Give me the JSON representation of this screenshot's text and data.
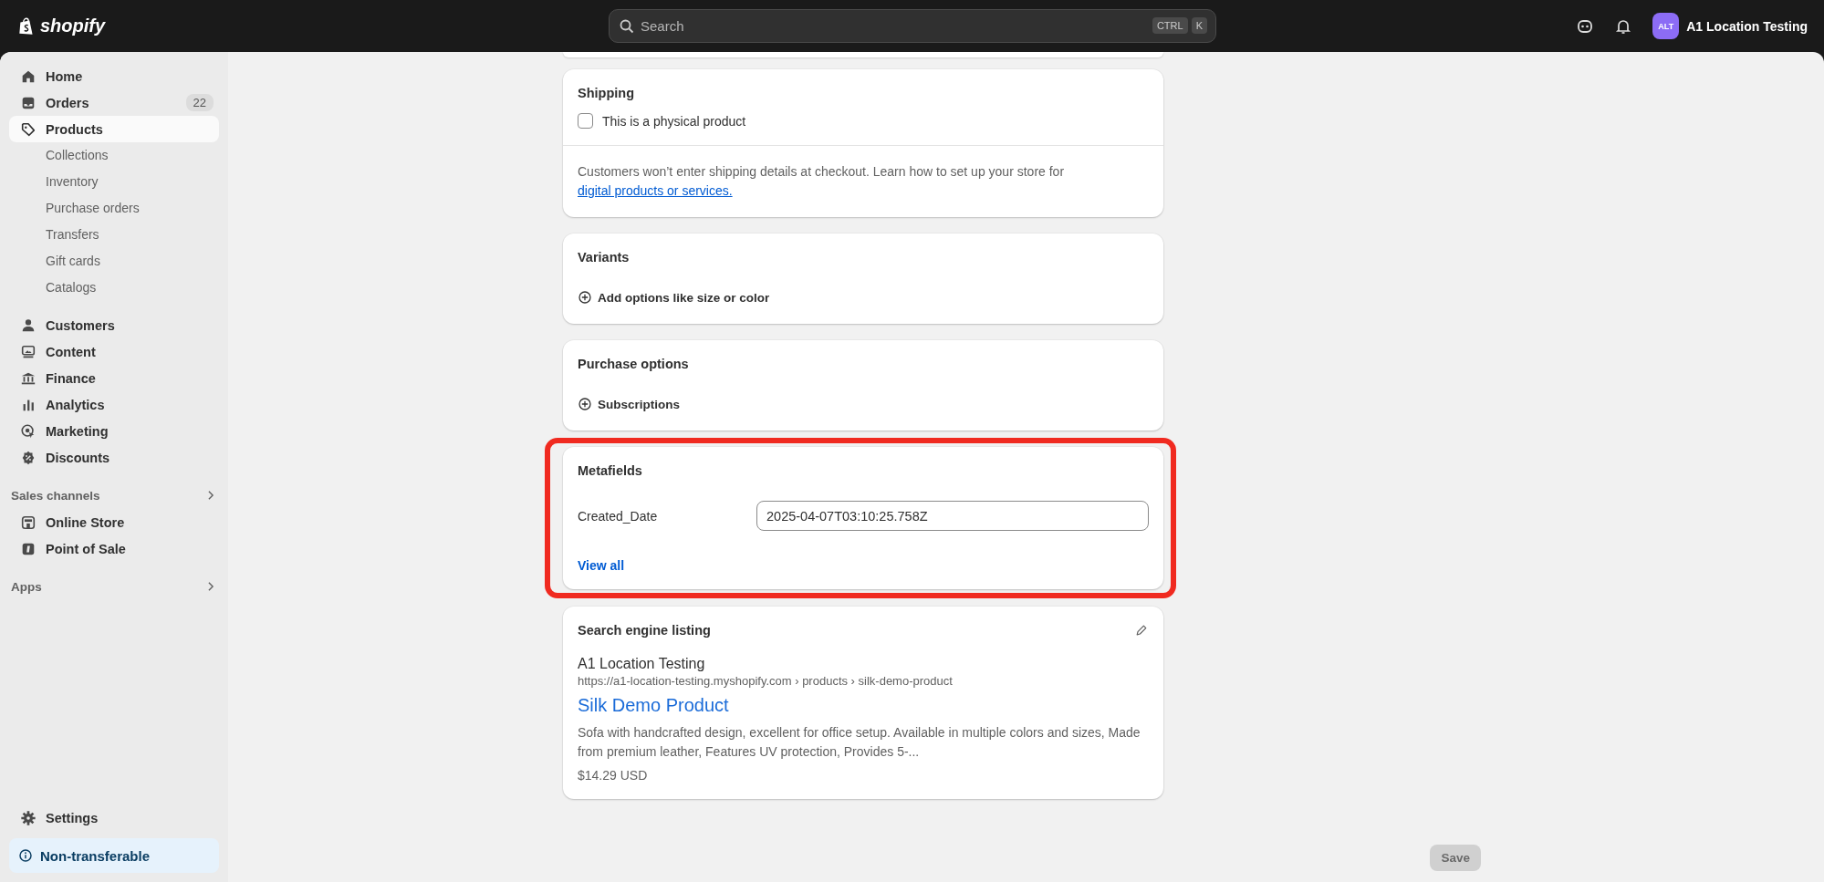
{
  "topbar": {
    "logo": "shopify",
    "search": {
      "placeholder": "Search",
      "keys": [
        "CTRL",
        "K"
      ]
    },
    "store": {
      "initials": "ALT",
      "name": "A1 Location Testing"
    }
  },
  "sidebar": {
    "groups": [
      {
        "items": [
          {
            "label": "Home",
            "kind": "home",
            "selected": false
          },
          {
            "label": "Orders",
            "kind": "inbox",
            "selected": false,
            "badge": "22"
          },
          {
            "label": "Products",
            "kind": "tag",
            "selected": true,
            "children": [
              {
                "label": "Collections",
                "selected": false
              },
              {
                "label": "Inventory",
                "selected": false
              },
              {
                "label": "Purchase orders",
                "selected": false
              },
              {
                "label": "Transfers",
                "selected": false
              },
              {
                "label": "Gift cards",
                "selected": false
              },
              {
                "label": "Catalogs",
                "selected": false
              }
            ]
          }
        ]
      },
      {
        "items": [
          {
            "label": "Customers",
            "kind": "person",
            "selected": false
          },
          {
            "label": "Content",
            "kind": "image",
            "selected": false
          },
          {
            "label": "Finance",
            "kind": "bank",
            "selected": false
          },
          {
            "label": "Analytics",
            "kind": "bars",
            "selected": false
          },
          {
            "label": "Marketing",
            "kind": "target",
            "selected": false
          },
          {
            "label": "Discounts",
            "kind": "badge",
            "selected": false
          }
        ]
      },
      {
        "title": "Sales channels",
        "items": [
          {
            "label": "Online Store",
            "kind": "store",
            "selected": false
          },
          {
            "label": "Point of Sale",
            "kind": "pos",
            "selected": false
          }
        ]
      },
      {
        "title": "Apps"
      }
    ],
    "settings": {
      "label": "Settings",
      "selected": false
    },
    "notice": {
      "label": "Non-transferable"
    }
  },
  "cards": [
    {
      "kind": "shipping",
      "title": "Shipping",
      "checkbox": {
        "label": "This is a physical product",
        "checked": false
      },
      "note": {
        "text": "Customers won’t enter shipping details at checkout. Learn how to set up your store for ",
        "link": "digital products or services."
      }
    },
    {
      "kind": "action",
      "title": "Variants",
      "action": "Add options like size or color"
    },
    {
      "kind": "action",
      "title": "Purchase options",
      "action": "Subscriptions"
    },
    {
      "kind": "metafields",
      "title": "Metafields",
      "highlighted": true,
      "fields": [
        {
          "label": "Created_Date",
          "value": "2025-04-07T03:10:25.758Z"
        }
      ],
      "link": "View all"
    },
    {
      "kind": "seo",
      "title": "Search engine listing",
      "store": "A1 Location Testing",
      "url": "https://a1-location-testing.myshopify.com › products › silk-demo-product",
      "product_title": "Silk Demo Product",
      "description": "Sofa with handcrafted design, excellent for office setup. Available in multiple colors and sizes, Made from premium leather, Features UV protection, Provides 5-...",
      "price": "$14.29 USD"
    }
  ],
  "save_button": {
    "label": "Save",
    "disabled": true
  }
}
